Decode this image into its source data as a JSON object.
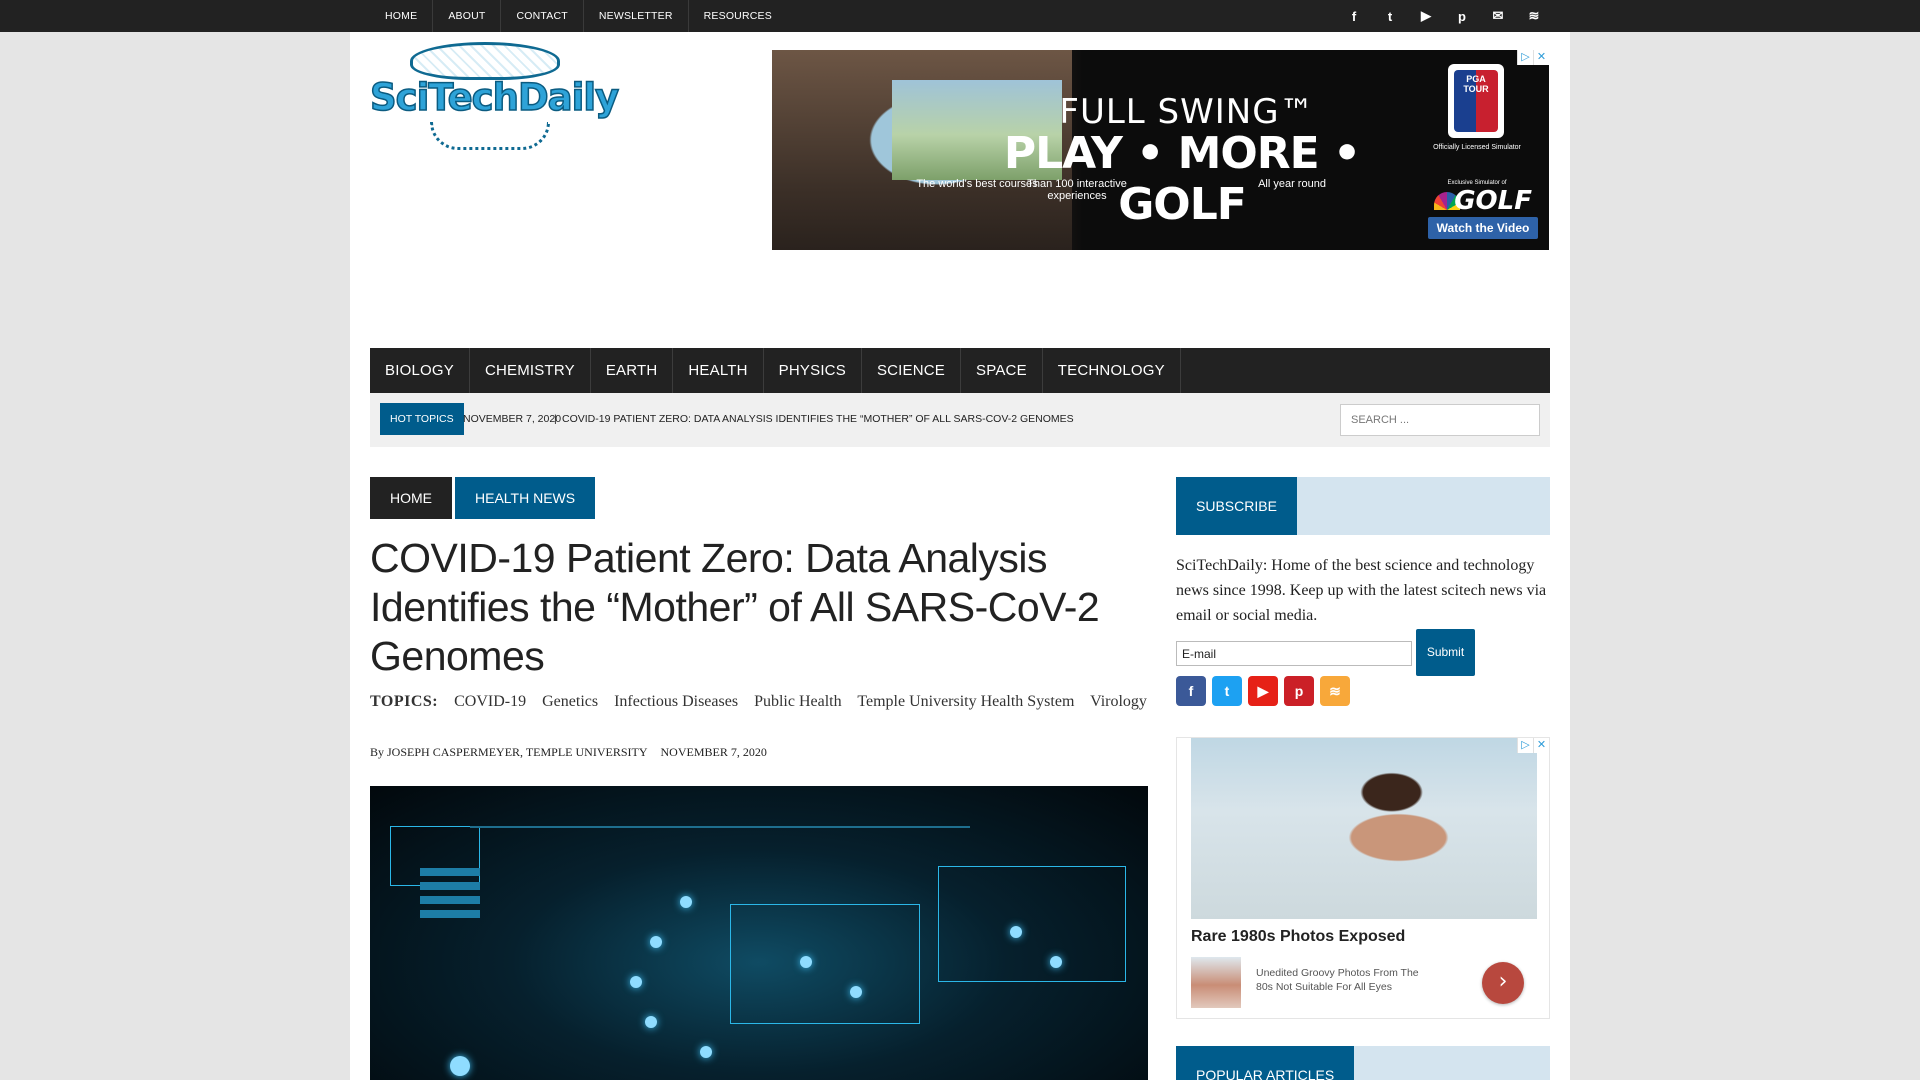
{
  "top_nav": [
    "HOME",
    "ABOUT",
    "CONTACT",
    "NEWSLETTER",
    "RESOURCES"
  ],
  "top_social_icons": [
    "f",
    "t",
    "▶",
    "p",
    "✉",
    "≋"
  ],
  "logo": {
    "text": "SciTechDaily"
  },
  "banner_ad": {
    "brand": "FULL SWING™",
    "headline": "PLAY • MORE • GOLF",
    "sub1": "The world's best courses",
    "sub2": "Than 100 interactive experiences",
    "sub3": "All year round",
    "pga": "PGA TOUR",
    "licensed": "Officially Licensed Simulator",
    "exclusive": "Exclusive Simulator of",
    "golf": "GOLF",
    "cta": "Watch the Video",
    "adchoices": "▷",
    "close": "✕"
  },
  "main_nav": [
    "BIOLOGY",
    "CHEMISTRY",
    "EARTH",
    "HEALTH",
    "PHYSICS",
    "SCIENCE",
    "SPACE",
    "TECHNOLOGY"
  ],
  "hot_topics": {
    "label": "HOT TOPICS",
    "date": "NOVEMBER 7, 2020",
    "separator": "|",
    "link": "COVID-19 PATIENT ZERO: DATA ANALYSIS IDENTIFIES THE “MOTHER” OF ALL SARS-COV-2 GENOMES"
  },
  "search": {
    "placeholder": "SEARCH ..."
  },
  "breadcrumb": {
    "home": "HOME",
    "section": "HEALTH NEWS"
  },
  "article": {
    "title": "COVID-19 Patient Zero: Data Analysis Identifies the “Mother” of All SARS-CoV-2 Genomes",
    "topics_label": "TOPICS:",
    "topics": [
      "COVID-19",
      "Genetics",
      "Infectious Diseases",
      "Public Health",
      "Temple University Health System",
      "Virology"
    ],
    "by": "By",
    "author": "JOSEPH CASPERMEYER, TEMPLE UNIVERSITY",
    "date": "NOVEMBER 7, 2020"
  },
  "sidebar": {
    "subscribe_title": "SUBSCRIBE",
    "subscribe_text": "SciTechDaily: Home of the best science and technology news since 1998. Keep up with the latest scitech news via email or social media.",
    "email_value": "E-mail",
    "submit_label": "Submit",
    "social_icons": [
      "f",
      "t",
      "▶",
      "p",
      "≋"
    ],
    "ad": {
      "headline": "Rare 1980s Photos Exposed",
      "desc": "Unedited Groovy Photos From The 80s Not Suitable For All Eyes",
      "arrow": "›"
    },
    "popular_title": "POPULAR ARTICLES"
  },
  "colors": {
    "accent": "#005c8c",
    "dark": "#222222",
    "light_blue": "#d4e4ef"
  }
}
